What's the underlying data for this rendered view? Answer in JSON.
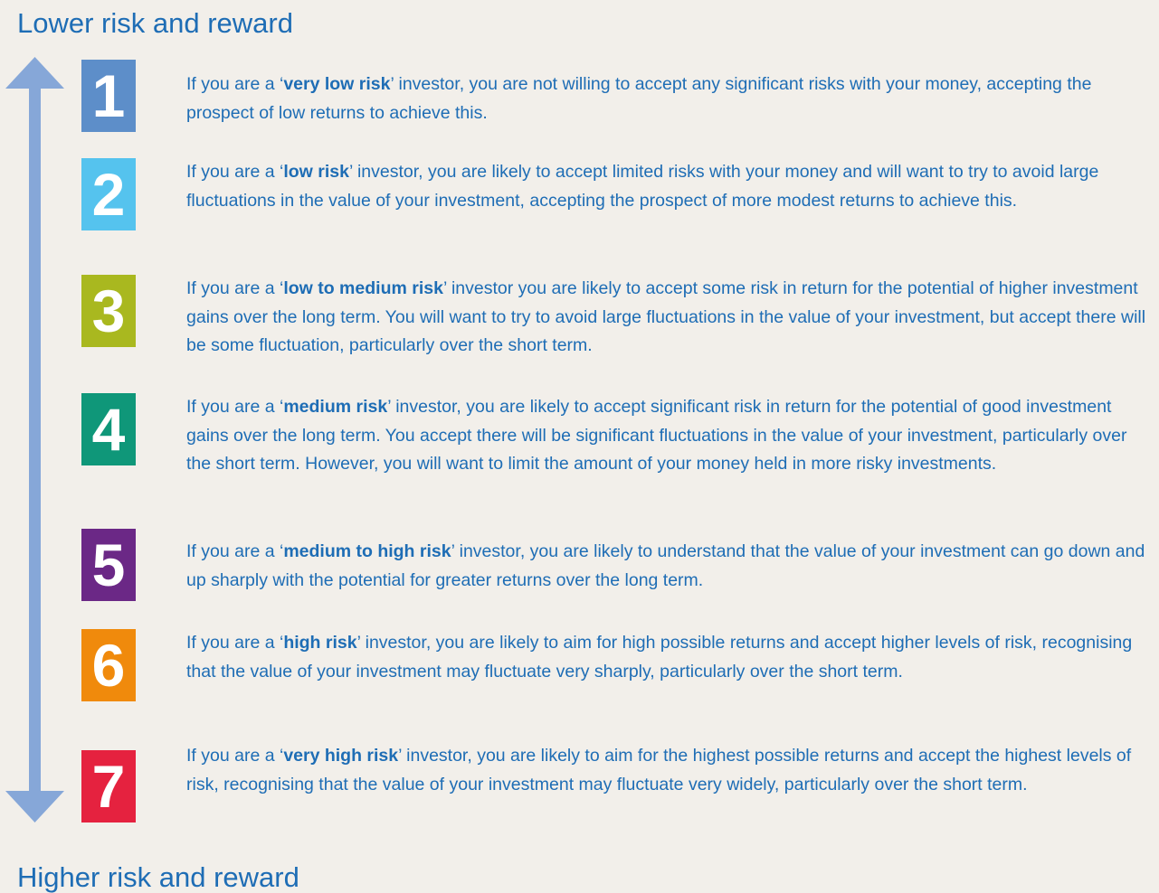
{
  "headings": {
    "top": "Lower risk and reward",
    "bottom": "Higher risk and reward"
  },
  "colors": {
    "background": "#f2efea",
    "text": "#1e6db5",
    "arrow": "#86a7d8"
  },
  "arrow": {
    "icon": "double-headed-vertical-arrow-icon"
  },
  "levels": [
    {
      "number": "1",
      "color": "#5d8ec9",
      "prefix": "If you are a ‘",
      "label": "very low risk",
      "suffix": "’ investor, you are not willing to accept any significant risks with your money, accepting the prospect of low returns to achieve this."
    },
    {
      "number": "2",
      "color": "#55c3ee",
      "prefix": "If you are a ‘",
      "label": "low risk",
      "suffix": "’ investor, you are likely to accept limited risks with your money and will want to try to avoid large fluctuations in the value of your investment, accepting the prospect of more modest returns to achieve this."
    },
    {
      "number": "3",
      "color": "#a9b81f",
      "prefix": "If you are a ‘",
      "label": "low to medium risk",
      "suffix": "’ investor you are likely to accept some risk in return for the potential of higher investment gains over the long term. You will want to try to avoid large fluctuations in the value of your investment, but accept there will be some fluctuation, particularly over the short term."
    },
    {
      "number": "4",
      "color": "#0f9779",
      "prefix": "If you are a ‘",
      "label": "medium risk",
      "suffix": "’ investor, you are likely to accept significant risk in return for the potential of good investment gains over the long term. You accept there will be significant fluctuations in the value of your investment, particularly over the short term. However, you will want to limit the amount of your money held in more risky investments."
    },
    {
      "number": "5",
      "color": "#6b2886",
      "prefix": "If you are a ‘",
      "label": "medium to high risk",
      "suffix": "’ investor, you are likely to understand that the value of your investment can go down and up sharply with the potential for greater returns over the long term."
    },
    {
      "number": "6",
      "color": "#f08a0c",
      "prefix": "If you are a ‘",
      "label": "high risk",
      "suffix": "’ investor, you are likely to aim for high possible returns and accept higher levels of risk, recognising that the value of your investment may fluctuate very sharply, particularly over the short term."
    },
    {
      "number": "7",
      "color": "#e5223f",
      "prefix": "If you are a ‘",
      "label": "very high risk",
      "suffix": "’ investor, you are likely to aim for the highest possible returns and accept the highest levels of risk, recognising that the value of your investment may fluctuate very widely, particularly over the short term."
    }
  ]
}
